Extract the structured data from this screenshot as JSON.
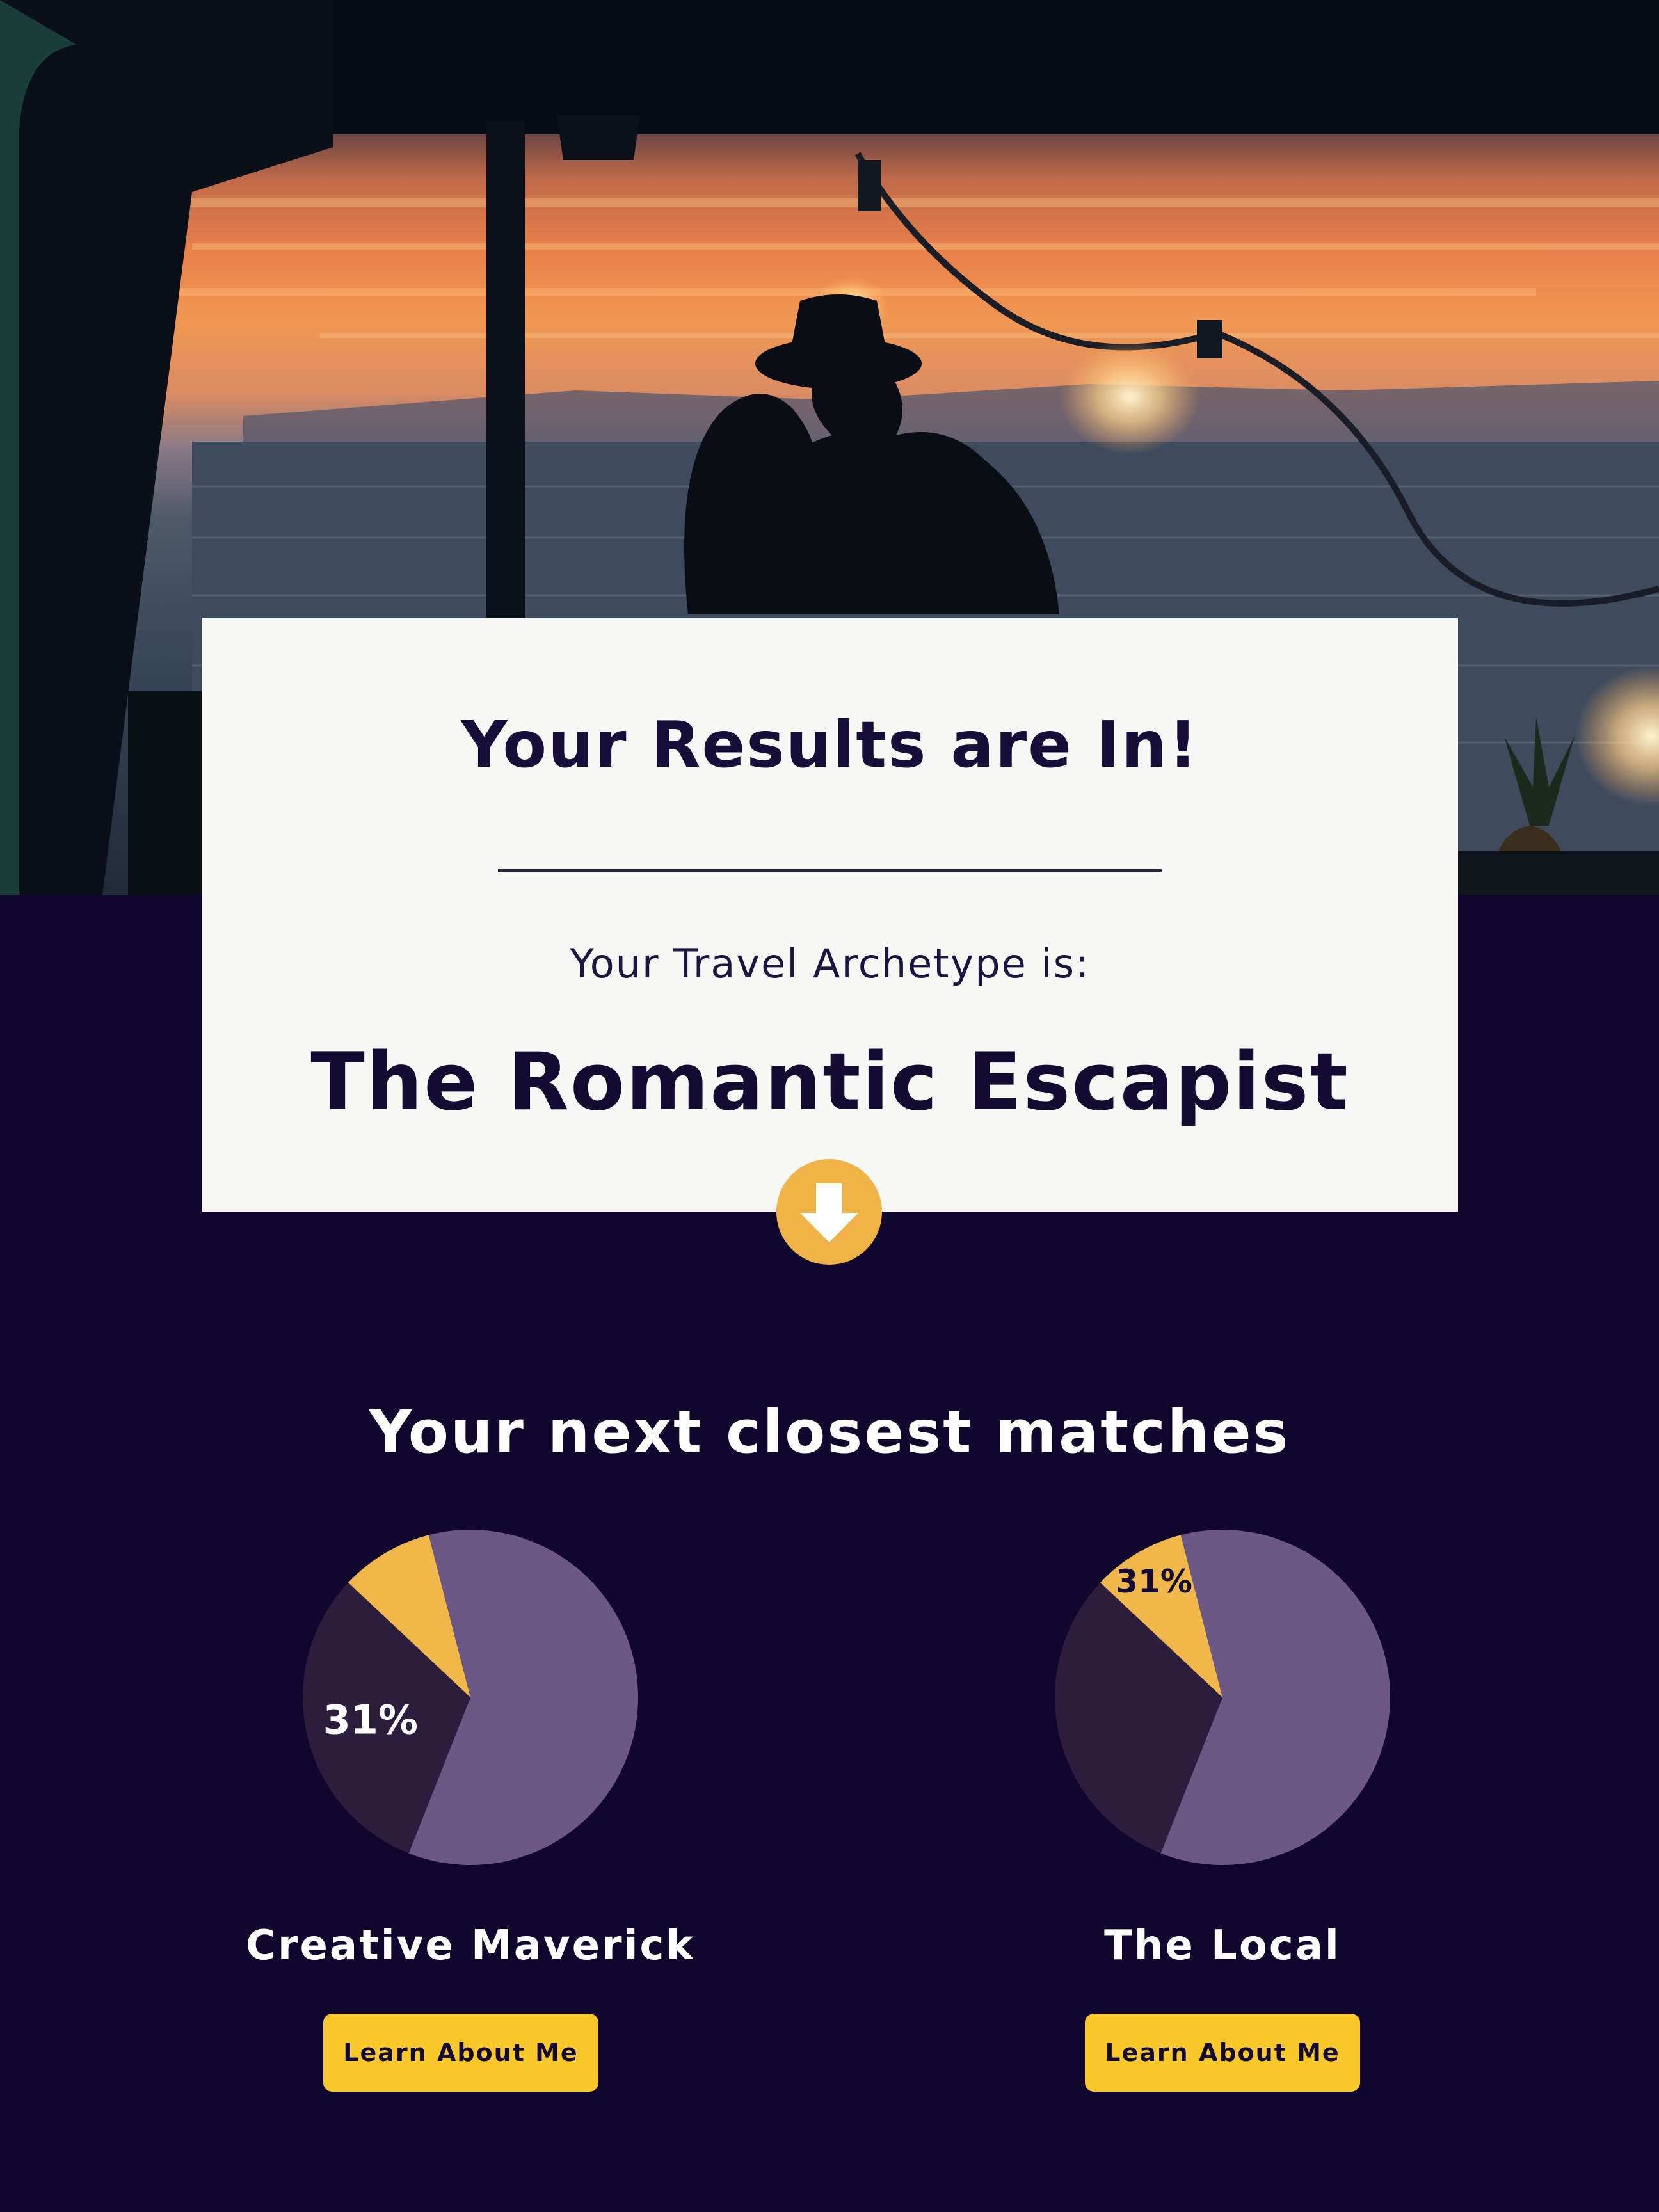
{
  "card": {
    "heading": "Your Results are In!",
    "intro": "Your Travel Archetype is:",
    "archetype": "The Romantic Escapist"
  },
  "matches_section": {
    "title": "Your next closest matches",
    "items": [
      {
        "name": "Creative Maverick",
        "button_label": "Learn About Me",
        "pie_label": "31%"
      },
      {
        "name": "The Local",
        "button_label": "Learn About Me",
        "pie_label": "31%"
      }
    ]
  },
  "colors": {
    "page_background": "#10062e",
    "card_background": "#f7f7f5",
    "accent_yellow": "#f9c82a",
    "pie_purple": "#6c5887",
    "pie_dark": "#2d1d3d",
    "pie_yellow": "#f0b84a"
  },
  "icons": {
    "scroll_down": "arrow-down-circle-icon"
  },
  "chart_data": [
    {
      "type": "pie",
      "title": "Creative Maverick",
      "slices": [
        {
          "label": "",
          "value": 56,
          "color": "#6c5887"
        },
        {
          "label": "31%",
          "value": 31,
          "color": "#2d1d3d"
        },
        {
          "label": "",
          "value": 9,
          "color": "#f0b84a"
        },
        {
          "label": "",
          "value": 4,
          "color": "#6c5887"
        }
      ]
    },
    {
      "type": "pie",
      "title": "The Local",
      "slices": [
        {
          "label": "",
          "value": 56,
          "color": "#6c5887"
        },
        {
          "label": "",
          "value": 31,
          "color": "#2d1d3d"
        },
        {
          "label": "31%",
          "value": 9,
          "color": "#f0b84a"
        },
        {
          "label": "",
          "value": 4,
          "color": "#6c5887"
        }
      ]
    }
  ]
}
